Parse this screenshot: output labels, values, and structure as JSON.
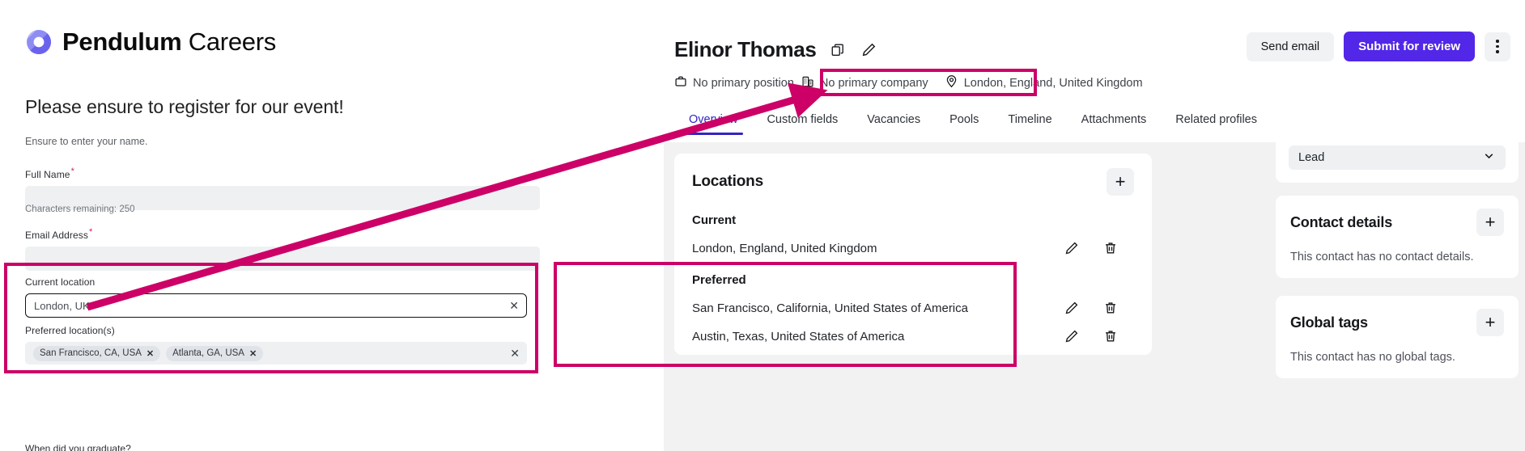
{
  "brand": {
    "name_bold": "Pendulum",
    "name_regular": "Careers",
    "logo_icon": "pendulum-logo-icon",
    "logo_color": "#7b7bf0"
  },
  "form": {
    "heading": "Please ensure to register for our event!",
    "subtext": "Ensure to enter your name.",
    "fields": {
      "full_name": {
        "label": "Full Name",
        "required_marker": "*",
        "value": "",
        "helper": "Characters remaining: 250"
      },
      "email": {
        "label": "Email Address",
        "required_marker": "*",
        "value": ""
      },
      "current_location": {
        "label": "Current location",
        "value": "London, UK",
        "clear_icon": "close-x-icon"
      },
      "preferred_locations": {
        "label": "Preferred location(s)",
        "chips": [
          "San Francisco, CA, USA",
          "Atlanta, GA, USA"
        ],
        "chip_remove_icon": "close-x-icon",
        "clear_icon": "close-x-icon"
      },
      "clipped_next_label": "When did you graduate?"
    }
  },
  "profile": {
    "name": "Elinor Thomas",
    "copy_icon": "copy-icon",
    "edit_icon": "pencil-icon",
    "meta": {
      "position_icon": "briefcase-icon",
      "position": "No primary position",
      "company_icon": "building-icon",
      "company": "No primary company",
      "location_icon": "map-pin-icon",
      "location": "London, England, United Kingdom"
    },
    "actions": {
      "send_email": "Send email",
      "submit_for_review": "Submit for review",
      "more_icon": "kebab-menu-icon"
    },
    "tabs": [
      {
        "label": "Overview",
        "active": true
      },
      {
        "label": "Custom fields",
        "active": false
      },
      {
        "label": "Vacancies",
        "active": false
      },
      {
        "label": "Pools",
        "active": false
      },
      {
        "label": "Timeline",
        "active": false
      },
      {
        "label": "Attachments",
        "active": false
      },
      {
        "label": "Related profiles",
        "active": false
      }
    ]
  },
  "locations_card": {
    "title": "Locations",
    "add_icon": "plus-icon",
    "groups": [
      {
        "heading": "Current",
        "items": [
          {
            "text": "London, England, United Kingdom",
            "edit_icon": "pencil-icon",
            "delete_icon": "trash-icon"
          }
        ]
      },
      {
        "heading": "Preferred",
        "items": [
          {
            "text": "San Francisco, California, United States of America",
            "edit_icon": "pencil-icon",
            "delete_icon": "trash-icon"
          },
          {
            "text": "Austin, Texas, United States of America",
            "edit_icon": "pencil-icon",
            "delete_icon": "trash-icon"
          }
        ]
      }
    ]
  },
  "sidebar": {
    "stage": {
      "value": "Lead",
      "chevron_icon": "chevron-down-icon"
    },
    "contact_details": {
      "title": "Contact details",
      "add_icon": "plus-icon",
      "empty": "This contact has no contact details."
    },
    "global_tags": {
      "title": "Global tags",
      "add_icon": "plus-icon",
      "empty": "This contact has no global tags."
    }
  },
  "annotations": {
    "color": "#cc0066",
    "arrow": {
      "from_label": "current-location-field",
      "to_label": "profile-header-location"
    },
    "highlight_boxes": [
      "form-location-fields",
      "profile-header-location",
      "preferred-locations-group"
    ]
  }
}
